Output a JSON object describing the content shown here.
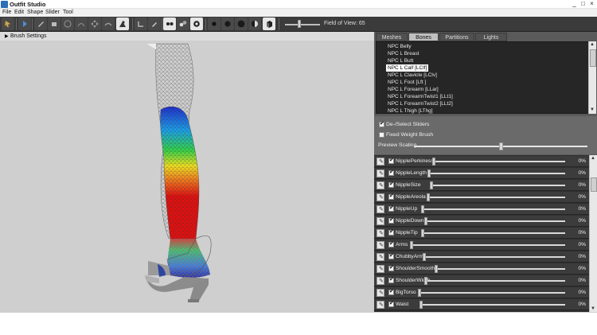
{
  "window": {
    "title": "Outfit Studio",
    "minimize": "_",
    "maximize": "□",
    "close": "×"
  },
  "menu": [
    "File",
    "Edit",
    "Shape",
    "Slider",
    "Tool"
  ],
  "toolbar": {
    "field_of_view_label": "Field of View: 65"
  },
  "viewport": {
    "brush_settings_label": "Brush Settings",
    "brush_settings_icon": "triangle-right-icon"
  },
  "tabs": [
    "Meshes",
    "Bones",
    "Partitions",
    "Lights"
  ],
  "active_tab": "Bones",
  "bones": [
    "NPC Belly",
    "NPC L Breast",
    "NPC L Butt",
    "NPC L Calf [LClf]",
    "NPC L Clavicle [LClv]",
    "NPC L Foot [Lft ]",
    "NPC L Forearm [LLar]",
    "NPC L ForearmTwist1 [LLt1]",
    "NPC L ForearmTwist2 [LLt2]",
    "NPC L Thigh [LThg]"
  ],
  "selected_bone": "NPC L Calf [LClf]",
  "options": {
    "deselect_sliders": "De-/Select Sliders",
    "fixed_weight_brush": "Fixed Weight Brush",
    "preview_scaling": "Preview Scaling",
    "preview_scaling_level": 0.5
  },
  "sliders": [
    {
      "name": "NipplePerkiness",
      "value": "0%"
    },
    {
      "name": "NippleLength",
      "value": "0%"
    },
    {
      "name": "NippleSize",
      "value": "0%"
    },
    {
      "name": "NippleAreola",
      "value": "0%"
    },
    {
      "name": "NippleUp",
      "value": "0%"
    },
    {
      "name": "NippleDown",
      "value": "0%"
    },
    {
      "name": "NippleTip",
      "value": "0%"
    },
    {
      "name": "Arms",
      "value": "0%"
    },
    {
      "name": "ChubbyArms",
      "value": "0%"
    },
    {
      "name": "ShoulderSmooth",
      "value": "0%"
    },
    {
      "name": "ShoulderWidth",
      "value": "0%"
    },
    {
      "name": "BigTorso",
      "value": "0%"
    },
    {
      "name": "Waist",
      "value": "0%"
    }
  ],
  "colors": {
    "toolbar": "#3b3b3b",
    "panel": "#5a5a5a",
    "viewport": "#cfcfcf",
    "weight_hot": "#e01010",
    "weight_cold": "#1010c0"
  }
}
